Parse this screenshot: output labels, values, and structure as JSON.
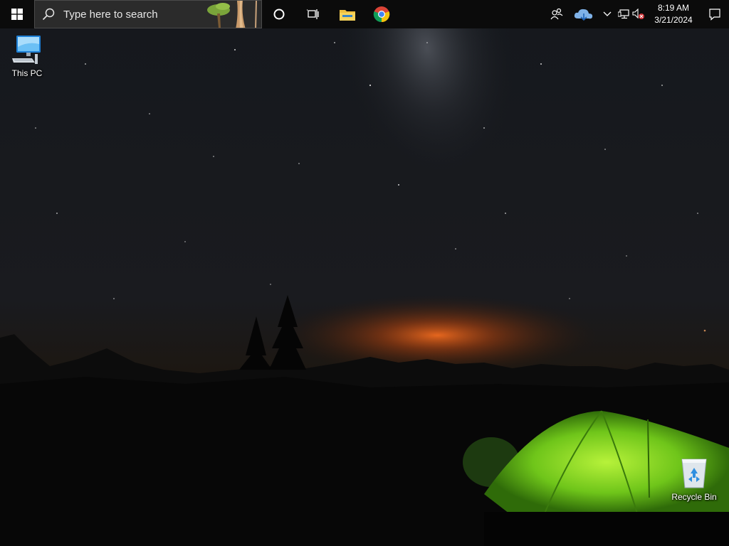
{
  "taskbar": {
    "search_placeholder": "Type here to search",
    "pinned": [
      {
        "name": "cortana-icon"
      },
      {
        "name": "task-view-icon"
      },
      {
        "name": "file-explorer-icon"
      },
      {
        "name": "chrome-icon"
      }
    ],
    "tray": {
      "icons": [
        "people-icon",
        "onedrive-cloud-icon",
        "chevron-up-icon",
        "network-icon",
        "volume-muted-icon"
      ],
      "time": "8:19 AM",
      "date": "3/21/2024"
    }
  },
  "desktop": {
    "icons": [
      {
        "label": "This PC",
        "icon": "computer-icon"
      },
      {
        "label": "Recycle Bin",
        "icon": "recycle-bin-icon"
      }
    ],
    "wallpaper": "night sky with milky way, mountains and a green tent"
  },
  "colors": {
    "taskbar_bg": "#0b0b0b",
    "search_bg": "#2b2b2b",
    "tent_green": "#7ed321",
    "horizon_glow": "#e8601c"
  }
}
